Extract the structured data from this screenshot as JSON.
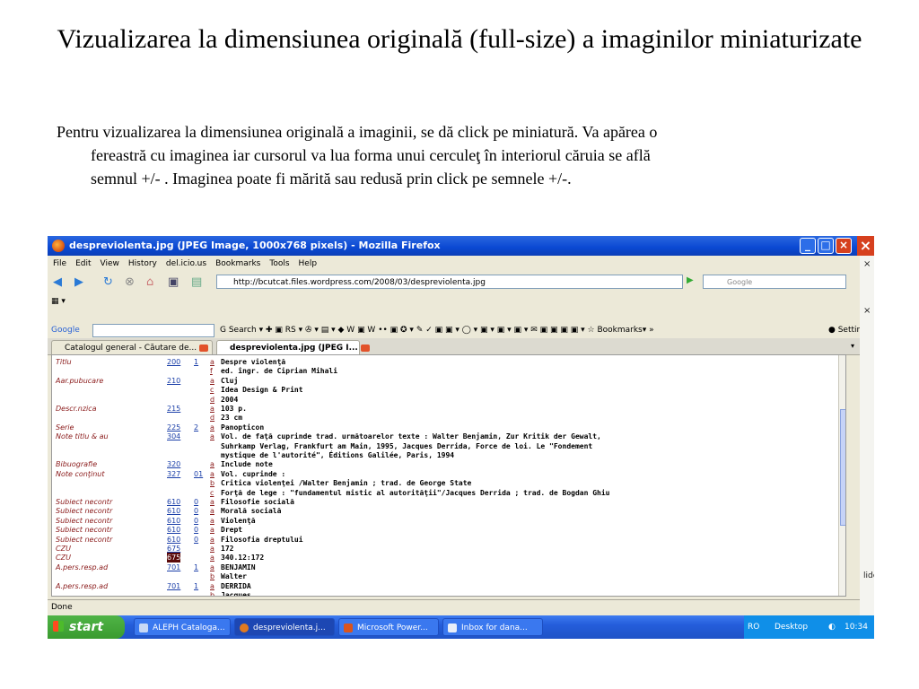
{
  "slide": {
    "title": "Vizualizarea la dimensiunea originală (full-size) a imaginilor miniaturizate",
    "paragraph_line1": "Pentru vizualizarea la dimensiunea originală a imaginii, se dă click pe  miniatură. Va apărea o",
    "paragraph_line2": "fereastră cu imaginea iar cursorul va lua forma unui cerculeţ în interiorul căruia se află",
    "paragraph_line3": "semnul +/- . Imaginea poate fi mărită sau redusă prin click pe semnele +/-."
  },
  "window": {
    "title": "despreviolenta.jpg (JPEG Image, 1000x768 pixels) - Mozilla Firefox",
    "menu": [
      "File",
      "Edit",
      "View",
      "History",
      "del.icio.us",
      "Bookmarks",
      "Tools",
      "Help"
    ],
    "url": "http://bcutcat.files.wordpress.com/2008/03/despreviolenta.jpg",
    "search_placeholder": "Google",
    "google_label": "Google",
    "google_search_label": "Search",
    "google_bookmarks_label": "Bookmarks",
    "google_settings_label": "Settings",
    "tabs": [
      {
        "label": "Catalogul general - Căutare de..."
      },
      {
        "label": "despreviolenta.jpg (JPEG I..."
      }
    ],
    "status": "Done",
    "side_label": "lide"
  },
  "record": [
    {
      "label": "Titlu",
      "tag": "200",
      "ind": "1",
      "sub": "a",
      "value": "Despre violenţă"
    },
    {
      "label": "",
      "tag": "",
      "ind": "",
      "sub": "f",
      "value": "ed. îngr. de Ciprian Mihali"
    },
    {
      "label": "Aar.pubucare",
      "tag": "210",
      "ind": "",
      "sub": "a",
      "value": "Cluj"
    },
    {
      "label": "",
      "tag": "",
      "ind": "",
      "sub": "c",
      "value": "Idea Design & Print"
    },
    {
      "label": "",
      "tag": "",
      "ind": "",
      "sub": "d",
      "value": "2004"
    },
    {
      "label": "Descr.nzica",
      "tag": "215",
      "ind": "",
      "sub": "a",
      "value": "103 p."
    },
    {
      "label": "",
      "tag": "",
      "ind": "",
      "sub": "d",
      "value": "23 cm"
    },
    {
      "label": "Serie",
      "tag": "225",
      "ind": "2",
      "sub": "a",
      "value": "Panopticon"
    },
    {
      "label": "Note titlu & au",
      "tag": "304",
      "ind": "",
      "sub": "a",
      "value": "Vol. de faţă cuprinde trad. următoarelor texte : Walter Benjamin, Zur Kritik der Gewalt,"
    },
    {
      "label": "",
      "tag": "",
      "ind": "",
      "sub": "",
      "value": "Suhrkamp Verlag, Frankfurt am Main, 1995, Jacques Derrida, Force de loi. Le \"Fondement"
    },
    {
      "label": "",
      "tag": "",
      "ind": "",
      "sub": "",
      "value": "mystique de l'autorité\", Éditions Galilée, Paris, 1994"
    },
    {
      "label": "Bibuografie",
      "tag": "320",
      "ind": "",
      "sub": "a",
      "value": "Include note"
    },
    {
      "label": "Note conţinut",
      "tag": "327",
      "ind": "01",
      "sub": "a",
      "value": "Vol. cuprinde :"
    },
    {
      "label": "",
      "tag": "",
      "ind": "",
      "sub": "b",
      "value": "Critica violenţei /Walter Benjamin ; trad. de George State"
    },
    {
      "label": "",
      "tag": "",
      "ind": "",
      "sub": "c",
      "value": "Forţă de lege : \"fundamentul mistic al autorităţii\"/Jacques Derrida ; trad. de Bogdan Ghiu"
    },
    {
      "label": "Subiect necontr",
      "tag": "610",
      "ind": "0",
      "sub": "a",
      "value": "Filosofie socială"
    },
    {
      "label": "Subiect necontr",
      "tag": "610",
      "ind": "0",
      "sub": "a",
      "value": "Morală socială"
    },
    {
      "label": "Subiect necontr",
      "tag": "610",
      "ind": "0",
      "sub": "a",
      "value": "Violenţă"
    },
    {
      "label": "Subiect necontr",
      "tag": "610",
      "ind": "0",
      "sub": "a",
      "value": "Drept"
    },
    {
      "label": "Subiect necontr",
      "tag": "610",
      "ind": "0",
      "sub": "a",
      "value": "Filosofia dreptului"
    },
    {
      "label": "CZU",
      "tag": "675",
      "ind": "",
      "sub": "a",
      "value": "172"
    },
    {
      "label": "CZU",
      "tag": "675",
      "ind": "",
      "sub": "a",
      "value": "340.12:172",
      "highlight": true
    },
    {
      "label": "A.pers.resp.ad",
      "tag": "701",
      "ind": "1",
      "sub": "a",
      "value": "BENJAMIN"
    },
    {
      "label": "",
      "tag": "",
      "ind": "",
      "sub": "b",
      "value": "Walter"
    },
    {
      "label": "A.pers.resp.ad",
      "tag": "701",
      "ind": "1",
      "sub": "a",
      "value": "DERRIDA"
    },
    {
      "label": "",
      "tag": "",
      "ind": "",
      "sub": "b",
      "value": "Jacques"
    }
  ],
  "taskbar": {
    "start": "start",
    "items": [
      "ALEPH Cataloga...",
      "despreviolenta.j...",
      "Microsoft Power...",
      "Inbox for dana..."
    ],
    "lang": "RO",
    "desktop": "Desktop",
    "time": "10:34"
  },
  "colors": {
    "titlebar": "#0a48d2",
    "field_label": "#8a1a1a",
    "tag_link": "#1a3ea8",
    "taskbar": "#245ddb",
    "start": "#3a9b2f"
  }
}
